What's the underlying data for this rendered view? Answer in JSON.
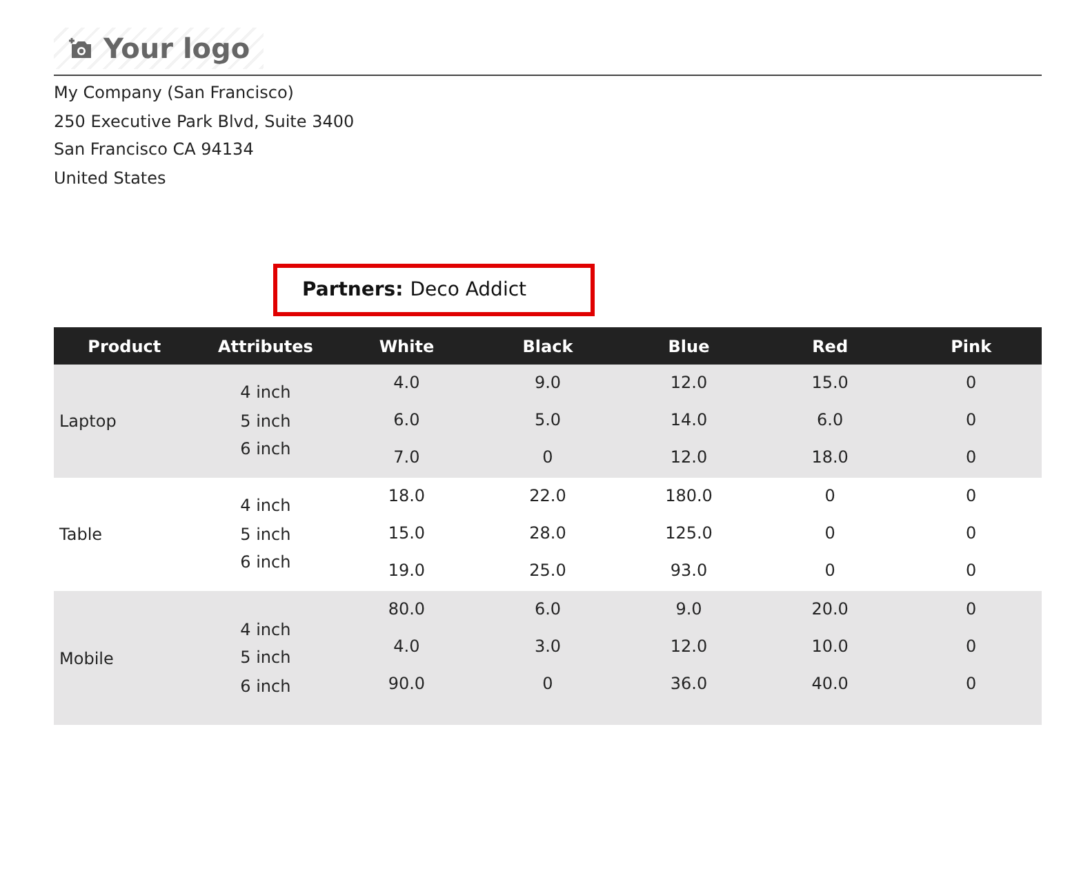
{
  "logo": {
    "text": "Your logo"
  },
  "company_address": [
    "My Company (San Francisco)",
    "250 Executive Park Blvd, Suite 3400",
    "San Francisco CA 94134",
    "United States"
  ],
  "partner": {
    "label": "Partners:",
    "value": "Deco Addict"
  },
  "table": {
    "columns": [
      "Product",
      "Attributes",
      "White",
      "Black",
      "Blue",
      "Red",
      "Pink"
    ],
    "groups": [
      {
        "product": "Laptop",
        "attributes": [
          "4 inch",
          "5 inch",
          "6 inch"
        ],
        "rows": [
          [
            "4.0",
            "9.0",
            "12.0",
            "15.0",
            "0"
          ],
          [
            "6.0",
            "5.0",
            "14.0",
            "6.0",
            "0"
          ],
          [
            "7.0",
            "0",
            "12.0",
            "18.0",
            "0"
          ]
        ]
      },
      {
        "product": "Table",
        "attributes": [
          "4 inch",
          "5 inch",
          "6 inch"
        ],
        "rows": [
          [
            "18.0",
            "22.0",
            "180.0",
            "0",
            "0"
          ],
          [
            "15.0",
            "28.0",
            "125.0",
            "0",
            "0"
          ],
          [
            "19.0",
            "25.0",
            "93.0",
            "0",
            "0"
          ]
        ]
      },
      {
        "product": "Mobile",
        "attributes": [
          "4 inch",
          "5 inch",
          "6 inch"
        ],
        "rows": [
          [
            "80.0",
            "6.0",
            "9.0",
            "20.0",
            "0"
          ],
          [
            "4.0",
            "3.0",
            "12.0",
            "10.0",
            "0"
          ],
          [
            "90.0",
            "0",
            "36.0",
            "40.0",
            "0"
          ]
        ]
      }
    ]
  }
}
